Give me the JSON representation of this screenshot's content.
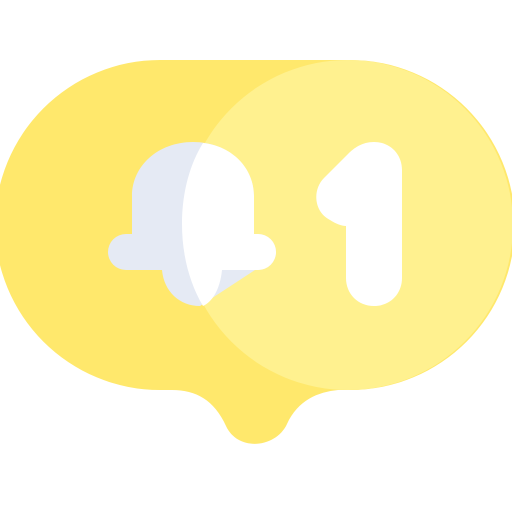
{
  "badge": {
    "icon": "notification-bell-icon",
    "count_shape": "1",
    "colors": {
      "bubble_left": "#FFE86C",
      "bubble_right": "#FFF18F",
      "bell_shade": "#E5EAF4",
      "bell_light": "#FFFFFF",
      "numeral": "#FFFFFF"
    }
  }
}
